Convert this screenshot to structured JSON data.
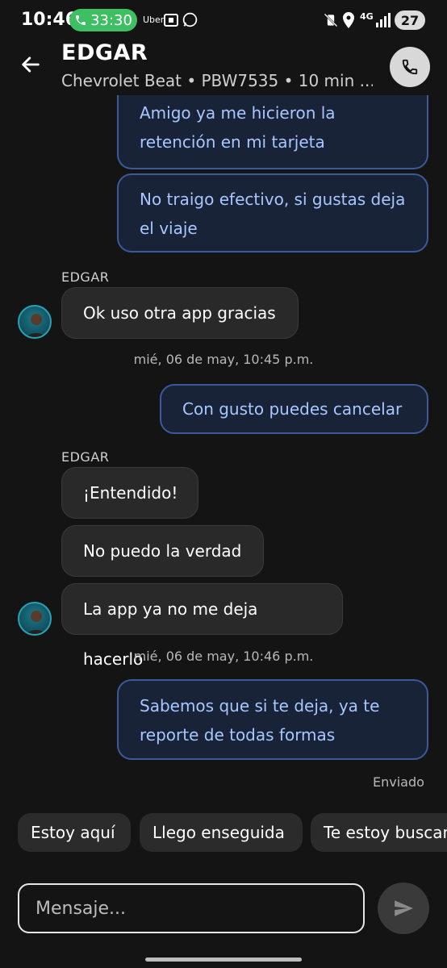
{
  "status_bar": {
    "time": "10:46",
    "call_timer": "33:30",
    "app_label": "Uber",
    "network": "4G",
    "battery": "27"
  },
  "header": {
    "name": "EDGAR",
    "subtitle": "Chevrolet Beat • PBW7535 • 10 min ..."
  },
  "messages": {
    "m1": "Amigo ya me hicieron la retención en mi tarjeta",
    "m2": "No traigo efectivo, si gustas deja el viaje",
    "sender1": "EDGAR",
    "m3": "Ok uso otra app gracias",
    "ts1": "mié, 06 de may, 10:45 p.m.",
    "m4": "Con gusto puedes cancelar",
    "sender2": "EDGAR",
    "m5": "¡Entendido!",
    "m6": "No puedo la verdad",
    "m7": "La app ya no me deja hacerlo",
    "ts2": "mié, 06 de may, 10:46 p.m.",
    "m8": "Sabemos que si te deja, ya te reporte de todas formas",
    "status": "Enviado"
  },
  "quick_replies": [
    "Estoy aquí",
    "Llego enseguida",
    "Te estoy buscando"
  ],
  "composer": {
    "placeholder": "Mensaje..."
  },
  "colors": {
    "my_bubble_bg": "#182338",
    "my_bubble_border": "#3a5a99",
    "my_text": "#a8c6ff",
    "their_bubble_bg": "#292929",
    "call_green": "#3fbf63"
  },
  "icons": {
    "back": "back-arrow-icon",
    "phone": "phone-icon",
    "send": "send-icon"
  }
}
